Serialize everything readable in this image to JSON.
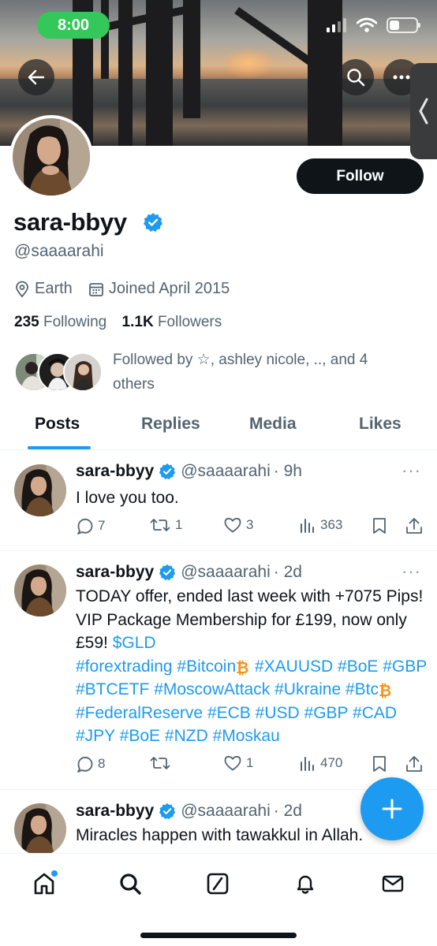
{
  "status_bar": {
    "time": "8:00"
  },
  "profile": {
    "display_name": "sara-bbyy",
    "handle": "@saaaarahi",
    "location": "Earth",
    "joined": "Joined April 2015",
    "following_count": "235",
    "following_label": "Following",
    "followers_count": "1.1K",
    "followers_label": "Followers",
    "followed_by": "Followed by ☆, ashley nicole, .., and 4 others",
    "follow_label": "Follow"
  },
  "tabs": [
    {
      "label": "Posts",
      "active": true
    },
    {
      "label": "Replies",
      "active": false
    },
    {
      "label": "Media",
      "active": false
    },
    {
      "label": "Likes",
      "active": false
    }
  ],
  "posts": [
    {
      "name": "sara-bbyy",
      "handle": "@saaaarahi",
      "time": "· 9h",
      "text": "I love you too.",
      "replies": "7",
      "reposts": "1",
      "likes": "3",
      "views": "363"
    },
    {
      "name": "sara-bbyy",
      "handle": "@saaaarahi",
      "time": "· 2d",
      "text_plain": "TODAY offer, ended last week with +7075 Pips! VIP Package Membership for £199, now only £59!",
      "cashtag": "$GLD",
      "hashtags": [
        "#forextrading",
        "#Bitcoin",
        "#XAUUSD",
        "#BoE",
        "#GBP",
        "#BTCETF",
        "#MoscowAttack",
        "#Ukraine",
        "#Btc",
        "#FederalReserve",
        "#ECB",
        "#USD",
        "#GBP",
        "#CAD",
        "#JPY",
        "#BoE",
        "#NZD",
        "#Moskau"
      ],
      "replies": "8",
      "reposts": "",
      "likes": "1",
      "views": "470"
    },
    {
      "name": "sara-bbyy",
      "handle": "@saaaarahi",
      "time": "· 2d",
      "text": "Miracles happen with tawakkul in Allah."
    }
  ],
  "icons": {
    "back": "arrow-left-icon",
    "search": "search-icon",
    "more": "more-icon",
    "location": "location-pin-icon",
    "calendar": "calendar-icon",
    "verified": "verified-badge-icon",
    "compose": "plus-icon",
    "nav": [
      "home-icon",
      "search-icon",
      "grok-icon",
      "bell-icon",
      "mail-icon"
    ]
  },
  "colors": {
    "accent": "#1d9bf0",
    "text": "#0f1419",
    "muted": "#536471",
    "status_green": "#34c759",
    "bitcoin": "#f7931a"
  }
}
